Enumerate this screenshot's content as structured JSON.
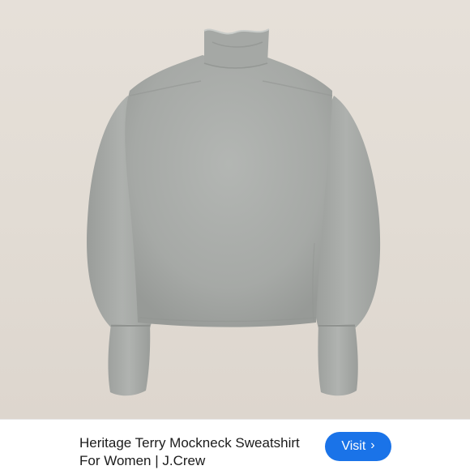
{
  "product": {
    "title_line1": "Heritage Terry Mockneck Sweatshirt",
    "title_line2": "For Women | J.Crew",
    "image_subject": "grey mockneck sweatshirt"
  },
  "actions": {
    "visit_label": "Visit",
    "visit_icon": "chevron-right-icon"
  },
  "colors": {
    "background": "#e4ded7",
    "sweatshirt": "#a9aca9",
    "button": "#1a73e8"
  }
}
